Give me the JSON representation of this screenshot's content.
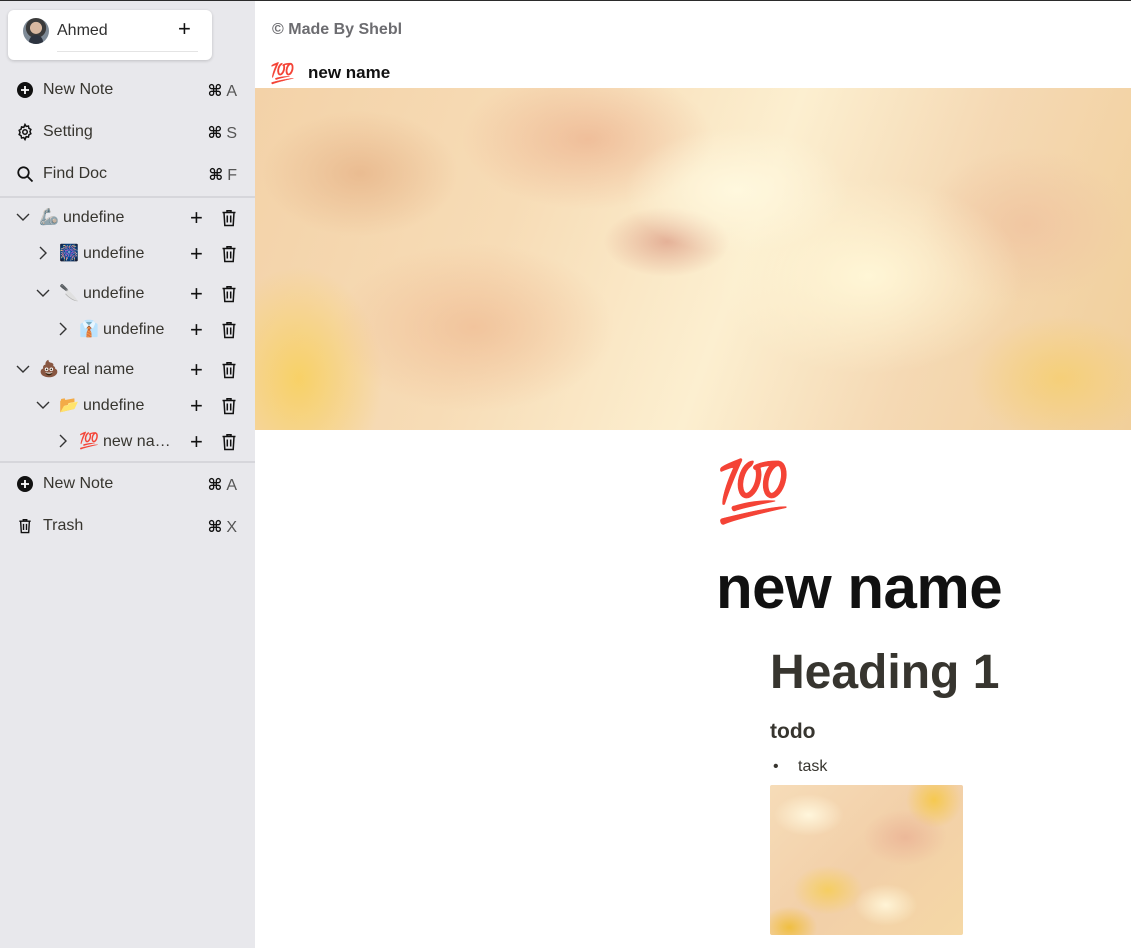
{
  "user": {
    "name": "Ahmed"
  },
  "menu_top": [
    {
      "label": "New Note",
      "key": "A",
      "icon": "plus-circle-icon"
    },
    {
      "label": "Setting",
      "key": "S",
      "icon": "gear-icon"
    },
    {
      "label": "Find Doc",
      "key": "F",
      "icon": "search-icon"
    }
  ],
  "shortcut_symbol": "⌘",
  "tree": [
    {
      "emoji": "🦾",
      "label": "undefine",
      "expanded": true
    },
    {
      "emoji": "🎆",
      "label": "undefine",
      "expanded": false
    },
    {
      "emoji": "🔪",
      "label": "undefine",
      "expanded": true
    },
    {
      "emoji": "👔",
      "label": "undefine",
      "expanded": false
    },
    {
      "emoji": "💩",
      "label": "real name",
      "expanded": true
    },
    {
      "emoji": "📂",
      "label": "undefine",
      "expanded": true
    },
    {
      "emoji": "💯",
      "label": "new name",
      "expanded": false
    }
  ],
  "menu_bottom": [
    {
      "label": "New Note",
      "key": "A",
      "icon": "plus-circle-icon"
    },
    {
      "label": "Trash",
      "key": "X",
      "icon": "trash-icon"
    }
  ],
  "main": {
    "credit": "© Made By Shebl",
    "breadcrumb": {
      "emoji": "💯",
      "title": "new name"
    },
    "page": {
      "emoji": "💯",
      "title": "new name",
      "heading1": "Heading 1",
      "todo_heading": "todo",
      "bullet": "•",
      "task": "task"
    }
  }
}
